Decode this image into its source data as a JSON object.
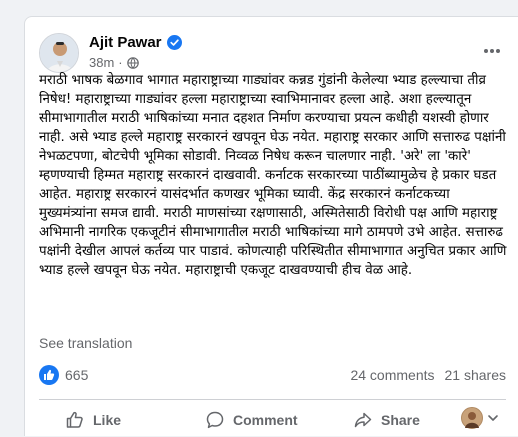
{
  "post": {
    "author_name": "Ajit Pawar",
    "timestamp": "38m",
    "separator": "·",
    "body": "मराठी भाषक बेळगाव भागात महाराष्ट्राच्या गाड्यांवर कन्नड गुंडांनी केलेल्या भ्याड हल्ल्याचा तीव्र निषेध! महाराष्ट्राच्या गाड्यांवर हल्ला महाराष्ट्राच्या स्वाभिमानावर हल्ला आहे. अशा हल्ल्यातून सीमाभागातील मराठी भाषिकांच्या मनात दहशत निर्माण करण्याचा प्रयत्न कधीही यशस्वी होणार नाही. असे भ्याड हल्ले महाराष्ट्र सरकारनं खपवून घेऊ नयेत. महाराष्ट्र सरकार आणि सत्तारुढ पक्षांनी नेभळटपणा, बोटचेपी भूमिका सोडावी. निव्वळ निषेध करून चालणार नाही. 'अरे' ला 'कारे' म्हणण्याची हिम्मत महाराष्ट्र सरकारनं दाखवावी. कर्नाटक सरकारच्या पाठींब्यामुळेच हे प्रकार घडत आहेत. महाराष्ट्र सरकारनं यासंदर्भात कणखर भूमिका घ्यावी. केंद्र सरकारनं कर्नाटकच्या मुख्यमंत्र्यांना समज द्यावी. मराठी माणसांच्या रक्षणासाठी, अस्मितेसाठी विरोधी पक्ष आणि महाराष्ट्र अभिमानी नागरिक एकजूटीनं सीमाभागातील मराठी भाषिकांच्या मागे ठामपणे उभे आहेत. सत्तारुढ पक्षांनी देखील आपलं कर्तव्य पार पाडावं. कोणत्याही परिस्थितीत सीमाभागात अनुचित प्रकार आणि भ्याड हल्ले खपवून घेऊ नयेत. महाराष्ट्राची एकजूट दाखवण्याची हीच वेळ आहे.",
    "see_translation": "See translation",
    "icons": {
      "verified": "verified-badge-icon",
      "audience": "globe-icon",
      "more": "more-options-icon"
    }
  },
  "stats": {
    "reaction_count": "665",
    "comments": "24 comments",
    "shares": "21 shares"
  },
  "actions": {
    "like": "Like",
    "comment": "Comment",
    "share": "Share"
  },
  "colors": {
    "background": "#f0f2f5",
    "card": "#ffffff",
    "brand_blue": "#1877f2",
    "secondary_text": "#65676b",
    "primary_text": "#050505"
  }
}
